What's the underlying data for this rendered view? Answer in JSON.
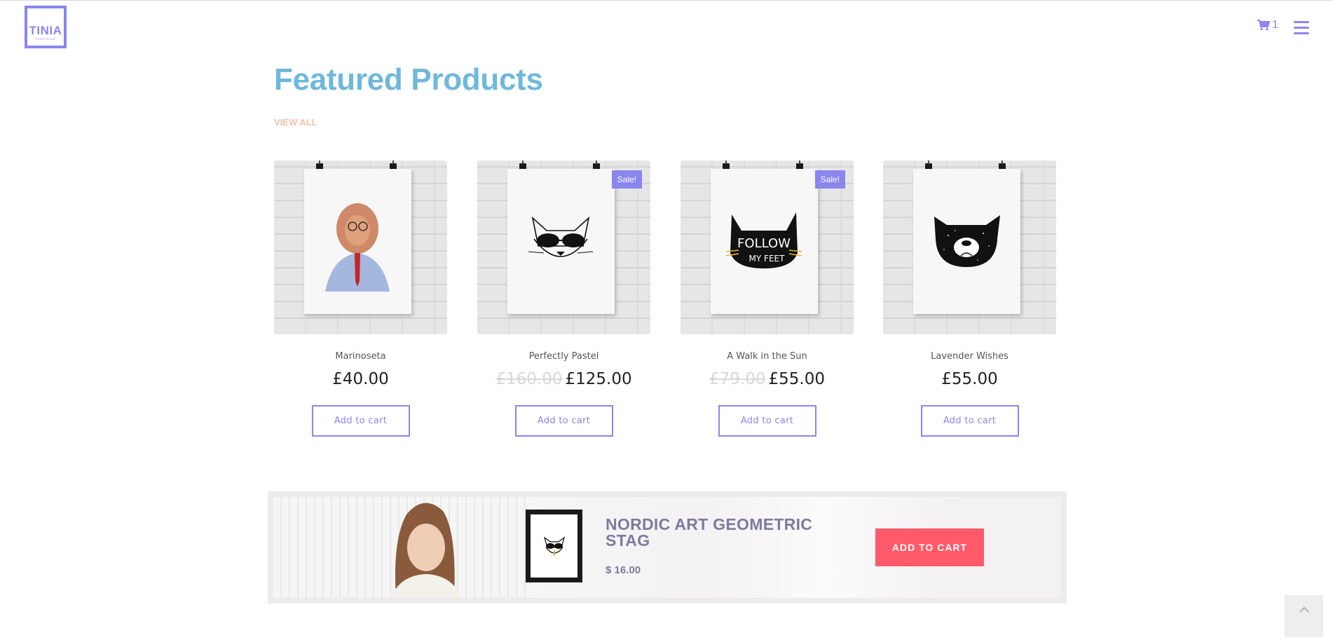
{
  "header": {
    "logo_text": "TINIA",
    "logo_subtext": "PRINT SHOP",
    "cart_count": "1",
    "accent_color": "#8a86ee"
  },
  "section": {
    "title": "Featured Products",
    "view_all": "VIEW ALL"
  },
  "products": [
    {
      "name": "Marinoseta",
      "old_price": "",
      "price": "£40.00",
      "sale_badge": "",
      "button": "Add to cart",
      "art": "lion-in-suit"
    },
    {
      "name": "Perfectly Pastel",
      "old_price": "£160.00",
      "price": "£125.00",
      "sale_badge": "Sale!",
      "button": "Add to cart",
      "art": "cat-with-sunglasses"
    },
    {
      "name": "A Walk in the Sun",
      "old_price": "£79.00",
      "price": "£55.00",
      "sale_badge": "Sale!",
      "button": "Add to cart",
      "art": "black-cat-follow-my-feet"
    },
    {
      "name": "Lavender Wishes",
      "old_price": "",
      "price": "£55.00",
      "sale_badge": "",
      "button": "Add to cart",
      "art": "black-bear-face"
    }
  ],
  "poster_text": {
    "line1": "FOLLOW",
    "line2": "MY FEET"
  },
  "banner": {
    "title": "NORDIC ART GEOMETRIC STAG",
    "price": "$ 16.00",
    "button": "ADD TO CART",
    "button_color": "#ff5a6a"
  }
}
